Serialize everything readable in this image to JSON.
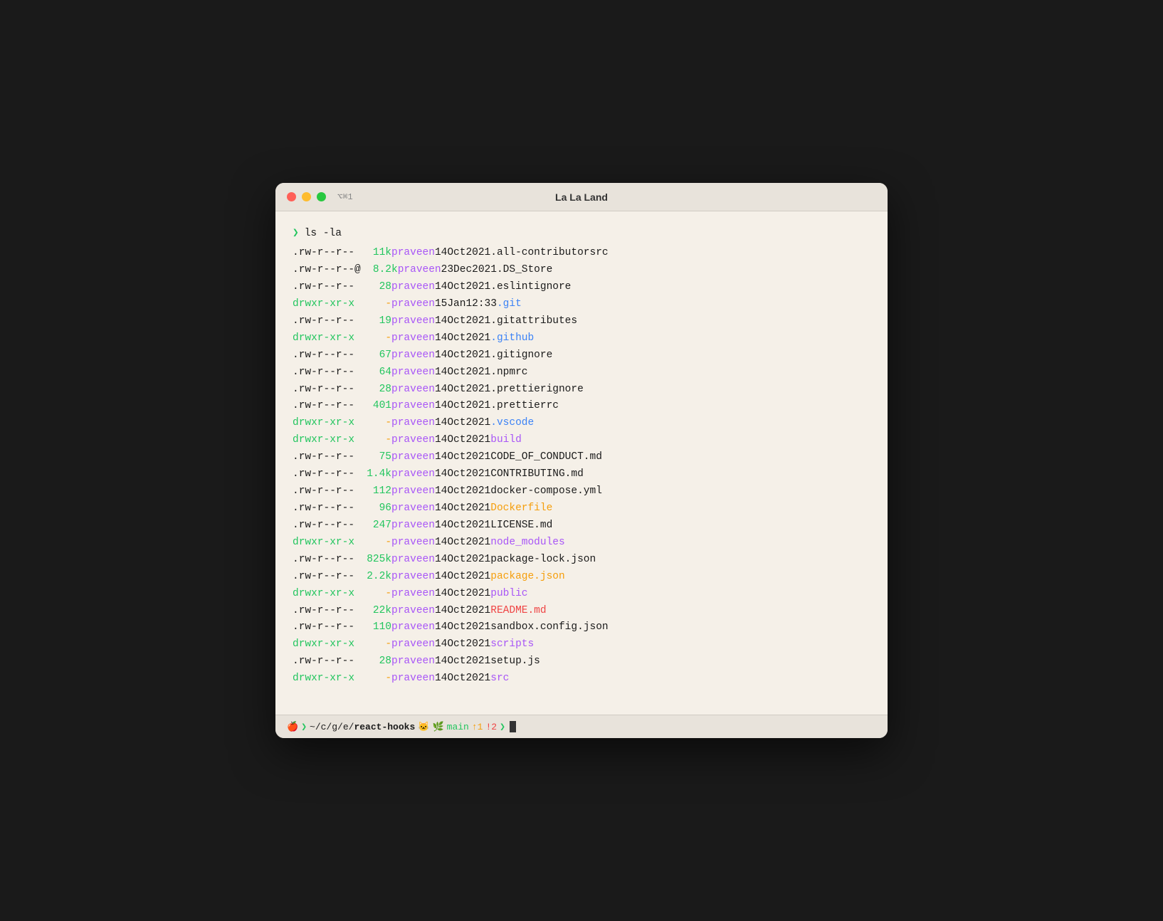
{
  "window": {
    "title": "La La Land",
    "shortcut": "⌥⌘1"
  },
  "terminal": {
    "command": "ls -la",
    "files": [
      {
        "perm": ".rw-r--r--",
        "is_dir": false,
        "size": "11k",
        "owner": "praveen",
        "day": "14",
        "mon": "Oct",
        "year": "2021",
        "name": ".all-contributorsrc",
        "color": "white"
      },
      {
        "perm": ".rw-r--r--@",
        "is_dir": false,
        "size": "8.2k",
        "owner": "praveen",
        "day": "23",
        "mon": "Dec",
        "year": "2021",
        "name": ".DS_Store",
        "color": "white"
      },
      {
        "perm": ".rw-r--r--",
        "is_dir": false,
        "size": "28",
        "owner": "praveen",
        "day": "14",
        "mon": "Oct",
        "year": "2021",
        "name": ".eslintignore",
        "color": "white"
      },
      {
        "perm": "drwxr-xr-x",
        "is_dir": true,
        "size": "-",
        "owner": "praveen",
        "day": "15",
        "mon": "Jan",
        "year": "12:33",
        "name": ".git",
        "color": "blue"
      },
      {
        "perm": ".rw-r--r--",
        "is_dir": false,
        "size": "19",
        "owner": "praveen",
        "day": "14",
        "mon": "Oct",
        "year": "2021",
        "name": ".gitattributes",
        "color": "white"
      },
      {
        "perm": "drwxr-xr-x",
        "is_dir": true,
        "size": "-",
        "owner": "praveen",
        "day": "14",
        "mon": "Oct",
        "year": "2021",
        "name": ".github",
        "color": "blue"
      },
      {
        "perm": ".rw-r--r--",
        "is_dir": false,
        "size": "67",
        "owner": "praveen",
        "day": "14",
        "mon": "Oct",
        "year": "2021",
        "name": ".gitignore",
        "color": "white"
      },
      {
        "perm": ".rw-r--r--",
        "is_dir": false,
        "size": "64",
        "owner": "praveen",
        "day": "14",
        "mon": "Oct",
        "year": "2021",
        "name": ".npmrc",
        "color": "white"
      },
      {
        "perm": ".rw-r--r--",
        "is_dir": false,
        "size": "28",
        "owner": "praveen",
        "day": "14",
        "mon": "Oct",
        "year": "2021",
        "name": ".prettierignore",
        "color": "white"
      },
      {
        "perm": ".rw-r--r--",
        "is_dir": false,
        "size": "401",
        "owner": "praveen",
        "day": "14",
        "mon": "Oct",
        "year": "2021",
        "name": ".prettierrc",
        "color": "white"
      },
      {
        "perm": "drwxr-xr-x",
        "is_dir": true,
        "size": "-",
        "owner": "praveen",
        "day": "14",
        "mon": "Oct",
        "year": "2021",
        "name": ".vscode",
        "color": "blue"
      },
      {
        "perm": "drwxr-xr-x",
        "is_dir": true,
        "size": "-",
        "owner": "praveen",
        "day": "14",
        "mon": "Oct",
        "year": "2021",
        "name": "build",
        "color": "purple"
      },
      {
        "perm": ".rw-r--r--",
        "is_dir": false,
        "size": "75",
        "owner": "praveen",
        "day": "14",
        "mon": "Oct",
        "year": "2021",
        "name": "CODE_OF_CONDUCT.md",
        "color": "white"
      },
      {
        "perm": ".rw-r--r--",
        "is_dir": false,
        "size": "1.4k",
        "owner": "praveen",
        "day": "14",
        "mon": "Oct",
        "year": "2021",
        "name": "CONTRIBUTING.md",
        "color": "white"
      },
      {
        "perm": ".rw-r--r--",
        "is_dir": false,
        "size": "112",
        "owner": "praveen",
        "day": "14",
        "mon": "Oct",
        "year": "2021",
        "name": "docker-compose.yml",
        "color": "white"
      },
      {
        "perm": ".rw-r--r--",
        "is_dir": false,
        "size": "96",
        "owner": "praveen",
        "day": "14",
        "mon": "Oct",
        "year": "2021",
        "name": "Dockerfile",
        "color": "yellow"
      },
      {
        "perm": ".rw-r--r--",
        "is_dir": false,
        "size": "247",
        "owner": "praveen",
        "day": "14",
        "mon": "Oct",
        "year": "2021",
        "name": "LICENSE.md",
        "color": "white"
      },
      {
        "perm": "drwxr-xr-x",
        "is_dir": true,
        "size": "-",
        "owner": "praveen",
        "day": "14",
        "mon": "Oct",
        "year": "2021",
        "name": "node_modules",
        "color": "purple"
      },
      {
        "perm": ".rw-r--r--",
        "is_dir": false,
        "size": "825k",
        "owner": "praveen",
        "day": "14",
        "mon": "Oct",
        "year": "2021",
        "name": "package-lock.json",
        "color": "white"
      },
      {
        "perm": ".rw-r--r--",
        "is_dir": false,
        "size": "2.2k",
        "owner": "praveen",
        "day": "14",
        "mon": "Oct",
        "year": "2021",
        "name": "package.json",
        "color": "yellow"
      },
      {
        "perm": "drwxr-xr-x",
        "is_dir": true,
        "size": "-",
        "owner": "praveen",
        "day": "14",
        "mon": "Oct",
        "year": "2021",
        "name": "public",
        "color": "purple"
      },
      {
        "perm": ".rw-r--r--",
        "is_dir": false,
        "size": "22k",
        "owner": "praveen",
        "day": "14",
        "mon": "Oct",
        "year": "2021",
        "name": "README.md",
        "color": "red"
      },
      {
        "perm": ".rw-r--r--",
        "is_dir": false,
        "size": "110",
        "owner": "praveen",
        "day": "14",
        "mon": "Oct",
        "year": "2021",
        "name": "sandbox.config.json",
        "color": "white"
      },
      {
        "perm": "drwxr-xr-x",
        "is_dir": true,
        "size": "-",
        "owner": "praveen",
        "day": "14",
        "mon": "Oct",
        "year": "2021",
        "name": "scripts",
        "color": "purple"
      },
      {
        "perm": ".rw-r--r--",
        "is_dir": false,
        "size": "28",
        "owner": "praveen",
        "day": "14",
        "mon": "Oct",
        "year": "2021",
        "name": "setup.js",
        "color": "white"
      },
      {
        "perm": "drwxr-xr-x",
        "is_dir": true,
        "size": "-",
        "owner": "praveen",
        "day": "14",
        "mon": "Oct",
        "year": "2021",
        "name": "src",
        "color": "purple"
      }
    ]
  },
  "statusbar": {
    "apple": "🍎",
    "folder": "❯",
    "path": "~/c/g/e/",
    "repo": "react-hooks",
    "cat_icon": "🐱",
    "branch_icon": "🌿",
    "branch": "main",
    "up": "↑1",
    "diff": "!2",
    "prompt": "❯"
  }
}
